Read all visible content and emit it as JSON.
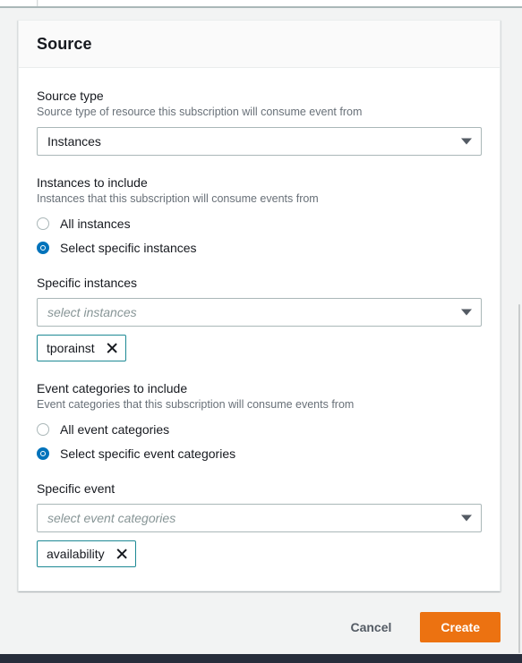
{
  "card": {
    "title": "Source"
  },
  "source_type": {
    "label": "Source type",
    "description": "Source type of resource this subscription will consume event from",
    "value": "Instances",
    "arrow_icon": "chevron-down-icon"
  },
  "instances_to_include": {
    "label": "Instances to include",
    "description": "Instances that this subscription will consume events from",
    "options": [
      {
        "label": "All instances",
        "selected": false
      },
      {
        "label": "Select specific instances",
        "selected": true
      }
    ]
  },
  "specific_instances": {
    "label": "Specific instances",
    "placeholder": "select instances",
    "value": "",
    "arrow_icon": "chevron-down-icon",
    "tokens": [
      {
        "label": "tporainst",
        "dismiss_icon": "close-icon"
      }
    ]
  },
  "event_categories_to_include": {
    "label": "Event categories to include",
    "description": "Event categories that this subscription will consume events from",
    "options": [
      {
        "label": "All event categories",
        "selected": false
      },
      {
        "label": "Select specific event categories",
        "selected": true
      }
    ]
  },
  "specific_event": {
    "label": "Specific event",
    "placeholder": "select event categories",
    "value": "",
    "arrow_icon": "chevron-down-icon",
    "tokens": [
      {
        "label": "availability",
        "dismiss_icon": "close-icon"
      }
    ]
  },
  "actions": {
    "cancel_label": "Cancel",
    "create_label": "Create"
  },
  "colors": {
    "accent_blue": "#0073bb",
    "primary_orange": "#ec7211",
    "token_border": "#1d8994",
    "bottom_bar": "#272d3b",
    "page_background": "#f2f3f3"
  }
}
